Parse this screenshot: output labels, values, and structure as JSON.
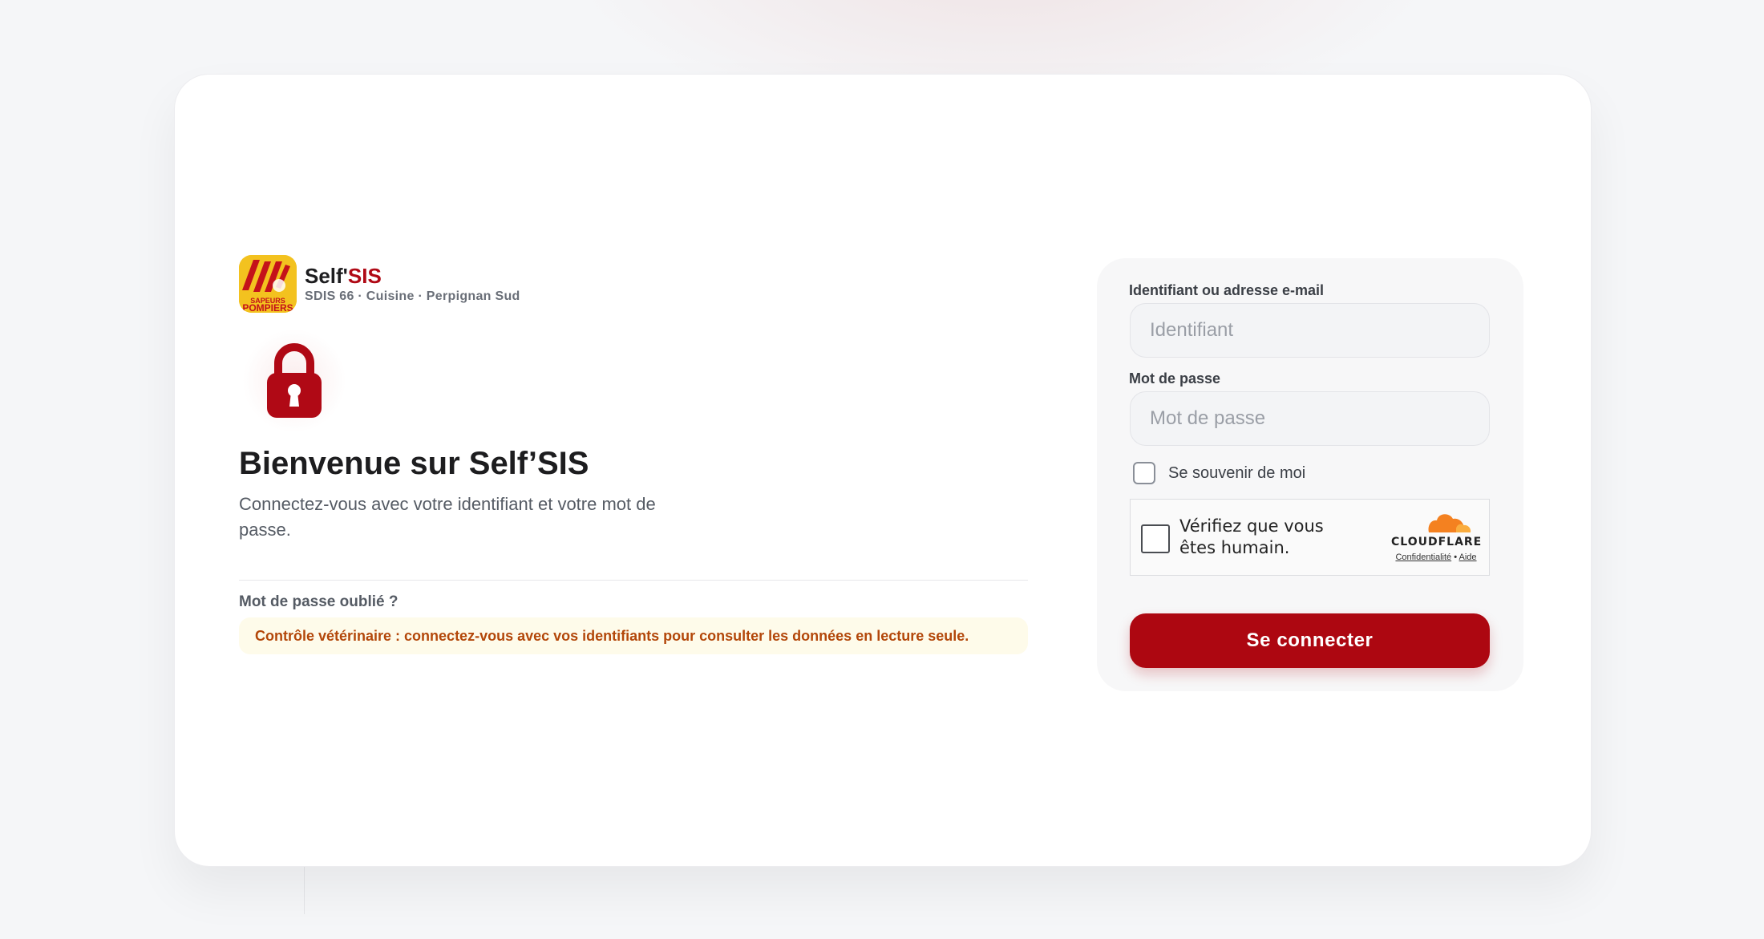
{
  "brand": {
    "name_main": "Self'",
    "name_accent": "SIS",
    "subtitle": "SDIS 66 · Cuisine · Perpignan Sud",
    "logo_icon": "sapeurs-pompiers-logo",
    "logo_text": "POMPIERS"
  },
  "intro": {
    "lock_icon": "lock-icon",
    "title": "Bienvenue sur Self’SIS",
    "description": "Connectez-vous avec votre identifiant et votre mot de passe."
  },
  "links": {
    "forgot_password": "Mot de passe oublié ?"
  },
  "notice": {
    "text": "Contrôle vétérinaire : connectez-vous avec vos identifiants pour consulter les données en lecture seule."
  },
  "form": {
    "username_label": "Identifiant ou adresse e-mail",
    "username_placeholder": "Identifiant",
    "username_value": "",
    "password_label": "Mot de passe",
    "password_placeholder": "Mot de passe",
    "password_value": "",
    "remember_label": "Se souvenir de moi",
    "remember_checked": false,
    "submit_label": "Se connecter"
  },
  "captcha": {
    "text": "Vérifiez que vous êtes humain.",
    "provider": "CLOUDFLARE",
    "privacy_link": "Confidentialité",
    "separator": "•",
    "help_link": "Aide",
    "icon": "cloudflare-cloud-icon"
  },
  "colors": {
    "accent": "#ad0711",
    "notice_bg": "#fefbea",
    "notice_text": "#b3470a",
    "cloudflare_orange": "#f48120"
  }
}
